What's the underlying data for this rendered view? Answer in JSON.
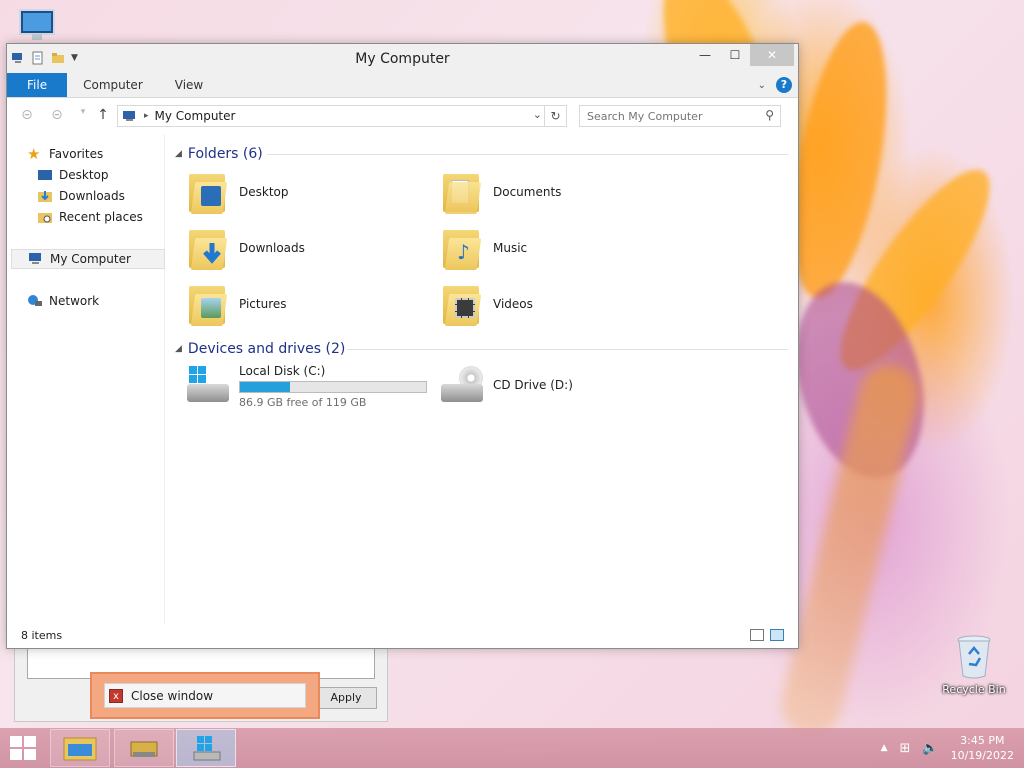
{
  "window": {
    "title": "My Computer",
    "minimize": "—",
    "maximize": "☐",
    "close": "✕"
  },
  "ribbon": {
    "tabs": [
      "File",
      "Computer",
      "View"
    ]
  },
  "address": {
    "path": "My Computer",
    "search_placeholder": "Search My Computer"
  },
  "nav": {
    "favorites": "Favorites",
    "items": [
      "Desktop",
      "Downloads",
      "Recent places"
    ],
    "my_computer": "My Computer",
    "network": "Network"
  },
  "folders": {
    "heading": "Folders (6)",
    "items": [
      "Desktop",
      "Documents",
      "Downloads",
      "Music",
      "Pictures",
      "Videos"
    ]
  },
  "drives": {
    "heading": "Devices and drives (2)",
    "local": {
      "name": "Local Disk (C:)",
      "free": "86.9 GB free of 119 GB",
      "used_fraction": 0.27
    },
    "cd": {
      "name": "CD Drive (D:)"
    }
  },
  "status": {
    "items": "8 items"
  },
  "background_dialog": {
    "apply": "Apply"
  },
  "tooltip": {
    "label": "Close window"
  },
  "desktop": {
    "recycle_bin": "Recycle Bin"
  },
  "taskbar": {
    "time": "3:45 PM",
    "date": "10/19/2022"
  },
  "colors": {
    "accent": "#1979ca",
    "drive_bar": "#26a0da"
  }
}
